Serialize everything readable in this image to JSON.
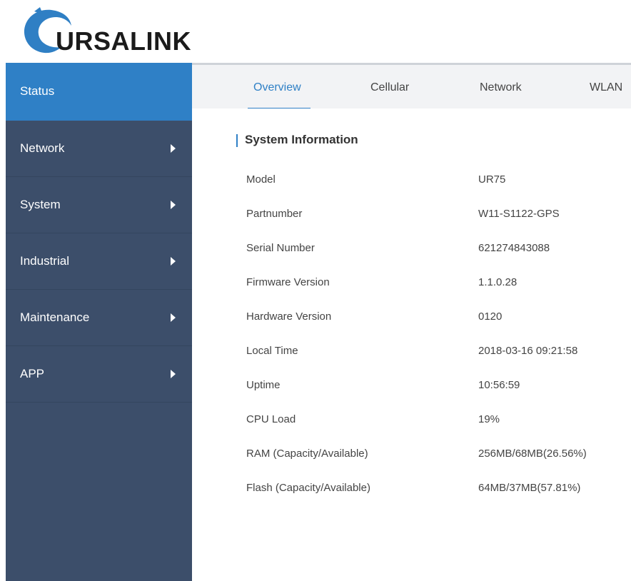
{
  "brand": {
    "logo_text": "URSALINK",
    "accent": "#2f80c6",
    "sidebar_bg": "#3c4e6a"
  },
  "sidebar": {
    "items": [
      {
        "label": "Status",
        "active": true,
        "has_submenu": false
      },
      {
        "label": "Network",
        "active": false,
        "has_submenu": true
      },
      {
        "label": "System",
        "active": false,
        "has_submenu": true
      },
      {
        "label": "Industrial",
        "active": false,
        "has_submenu": true
      },
      {
        "label": "Maintenance",
        "active": false,
        "has_submenu": true
      },
      {
        "label": "APP",
        "active": false,
        "has_submenu": true
      }
    ]
  },
  "tabs": [
    {
      "label": "Overview",
      "active": true
    },
    {
      "label": "Cellular",
      "active": false
    },
    {
      "label": "Network",
      "active": false
    },
    {
      "label": "WLAN",
      "active": false
    }
  ],
  "system_info": {
    "title": "System Information",
    "rows": [
      {
        "key": "Model",
        "value": "UR75"
      },
      {
        "key": "Partnumber",
        "value": "W11-S1122-GPS"
      },
      {
        "key": "Serial Number",
        "value": "621274843088"
      },
      {
        "key": "Firmware Version",
        "value": "1.1.0.28"
      },
      {
        "key": "Hardware Version",
        "value": "0120"
      },
      {
        "key": "Local Time",
        "value": "2018-03-16 09:21:58"
      },
      {
        "key": "Uptime",
        "value": "10:56:59"
      },
      {
        "key": "CPU Load",
        "value": "19%"
      },
      {
        "key": "RAM (Capacity/Available)",
        "value": "256MB/68MB(26.56%)"
      },
      {
        "key": "Flash (Capacity/Available)",
        "value": "64MB/37MB(57.81%)"
      }
    ]
  }
}
